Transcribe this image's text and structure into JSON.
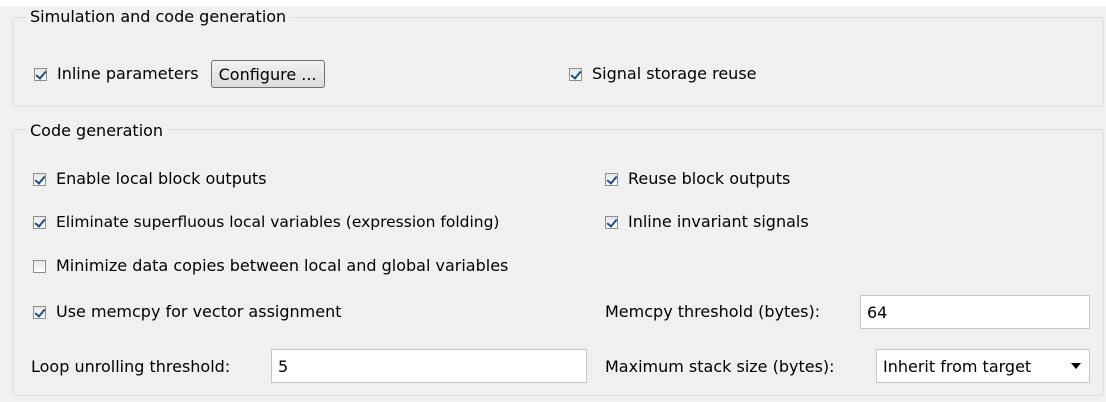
{
  "sim_group": {
    "title": "Simulation and code generation",
    "inline_parameters": {
      "label": "Inline parameters",
      "checked": true
    },
    "configure_button": "Configure ...",
    "signal_storage_reuse": {
      "label": "Signal storage reuse",
      "checked": true
    }
  },
  "codegen_group": {
    "title": "Code generation",
    "enable_local_block_outputs": {
      "label": "Enable local block outputs",
      "checked": true
    },
    "reuse_block_outputs": {
      "label": "Reuse block outputs",
      "checked": true
    },
    "eliminate_superfluous": {
      "label": "Eliminate superfluous local variables (expression folding)",
      "checked": true
    },
    "inline_invariant_signals": {
      "label": "Inline invariant signals",
      "checked": true
    },
    "minimize_data_copies": {
      "label": "Minimize data copies between local and global variables",
      "checked": false
    },
    "use_memcpy": {
      "label": "Use memcpy for vector assignment",
      "checked": true
    },
    "memcpy_threshold": {
      "label": "Memcpy threshold (bytes):",
      "value": "64"
    },
    "loop_unrolling": {
      "label": "Loop unrolling threshold:",
      "value": "5"
    },
    "max_stack_size": {
      "label": "Maximum stack size (bytes):",
      "value": "Inherit from target"
    }
  }
}
